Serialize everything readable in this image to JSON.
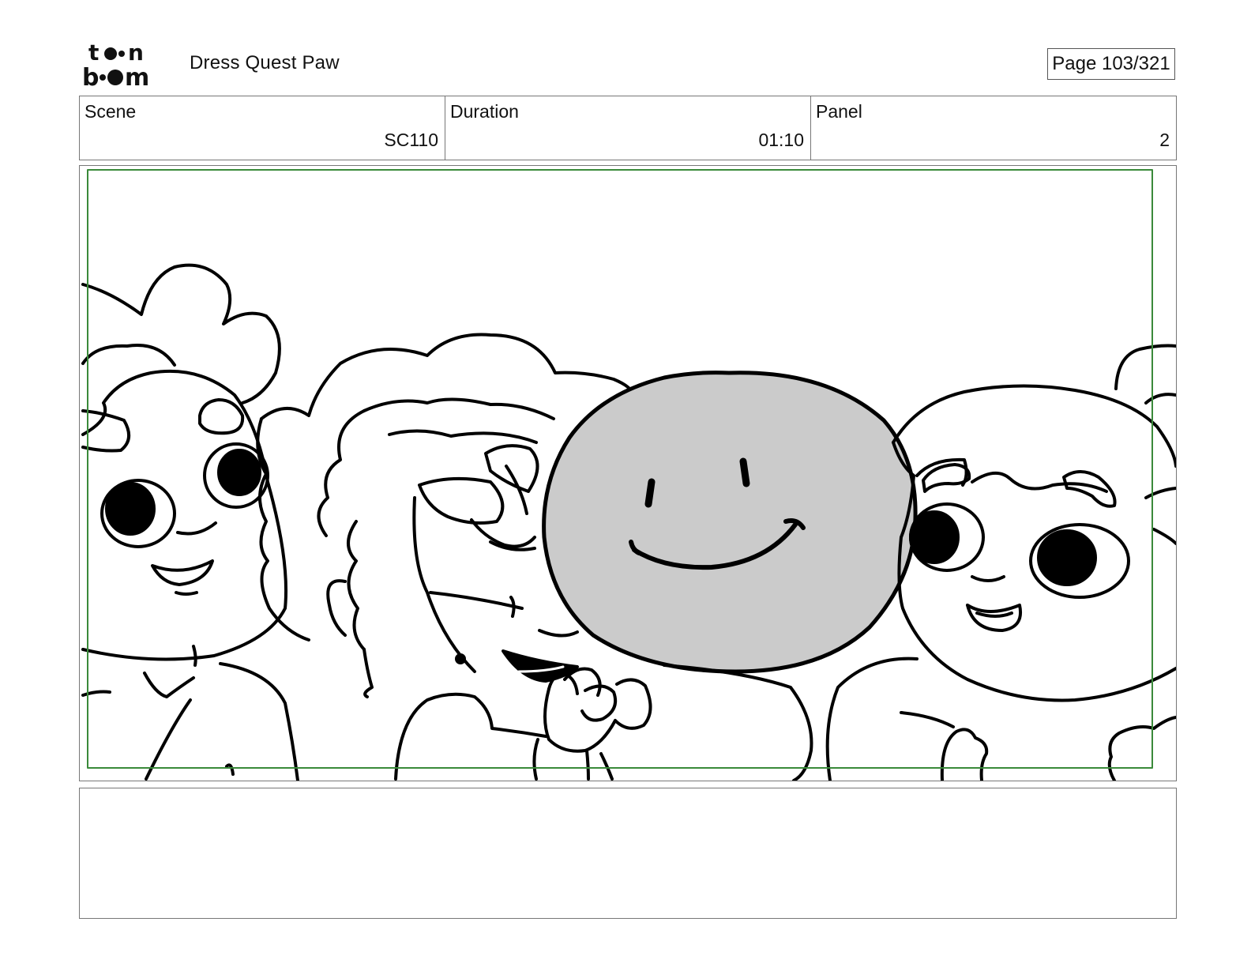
{
  "header": {
    "logo_top": "to",
    "logo_bottom": "b",
    "logo_alt": "toon boom",
    "project_title": "Dress Quest Paw",
    "page_label": "Page 103/321"
  },
  "info": {
    "scene_label": "Scene",
    "scene_value": "SC110",
    "duration_label": "Duration",
    "duration_value": "01:10",
    "panel_label": "Panel",
    "panel_value": "2"
  },
  "panel": {
    "safe_area_color": "#3a8a3a",
    "smiley_fill_color": "#cbcbcb",
    "line_color": "#000000"
  },
  "notes": {
    "text": ""
  }
}
